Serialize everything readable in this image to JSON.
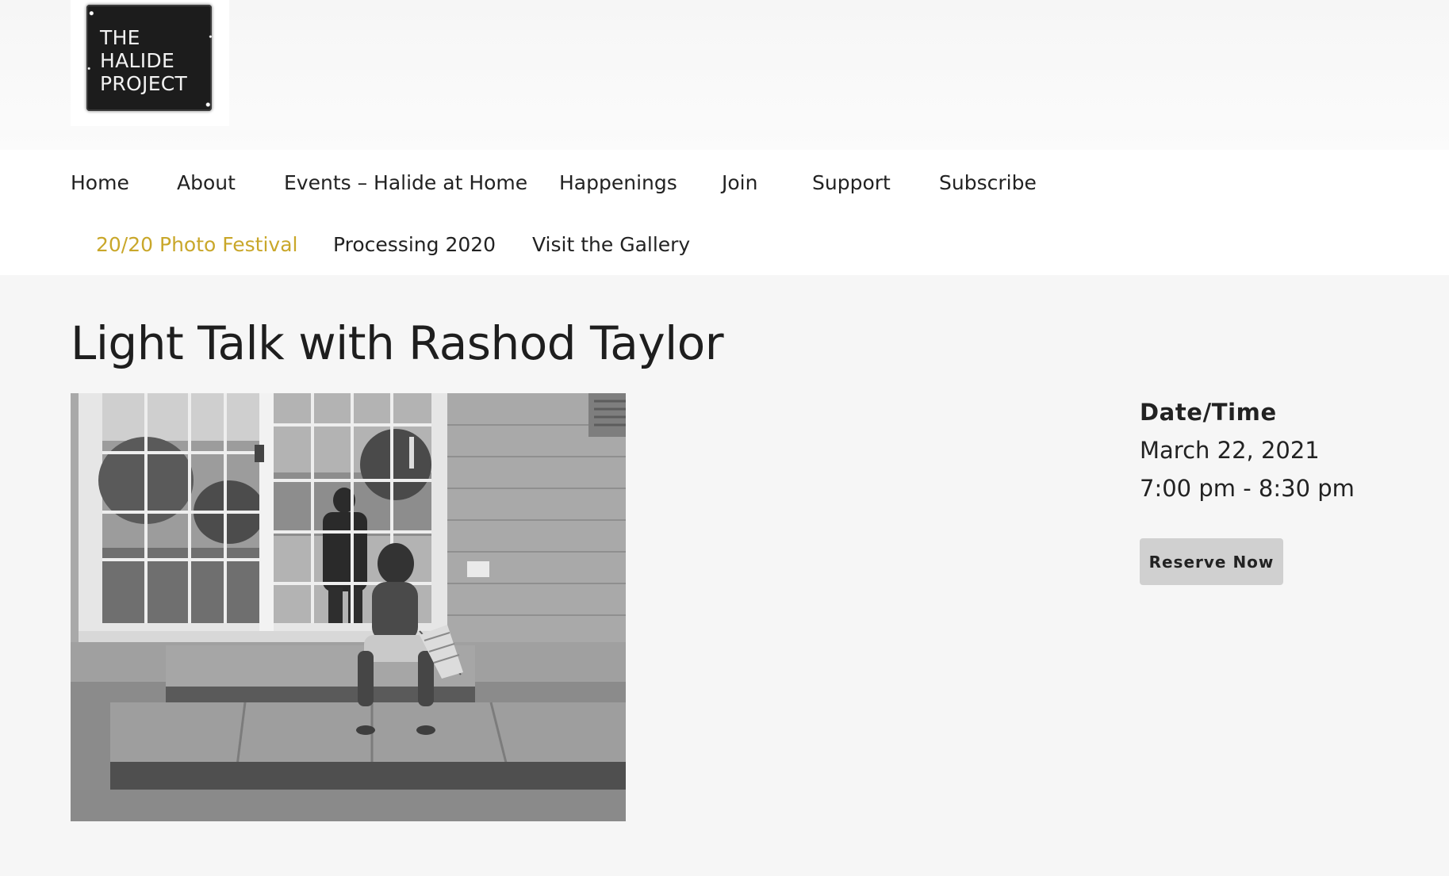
{
  "logo": {
    "lines": [
      "THE",
      "HALIDE",
      "PROJECT"
    ]
  },
  "nav": {
    "row1": [
      "Home",
      "About",
      "Events – Halide at Home",
      "Happenings",
      "Join",
      "Support",
      "Subscribe"
    ],
    "row2": [
      "20/20 Photo Festival",
      "Processing 2020",
      "Visit the Gallery"
    ],
    "active": "20/20 Photo Festival",
    "active_color": "#c9a72a"
  },
  "event": {
    "title": "Light Talk with Rashod Taylor",
    "photo_description_icon": "photo-image",
    "datetime_label": "Date/Time",
    "date": "March 22, 2021",
    "time": "7:00 pm - 8:30 pm",
    "reserve_label": "Reserve Now"
  },
  "colors": {
    "background": "#f6f6f6",
    "nav_background": "#ffffff",
    "button": "#d0d0d0"
  }
}
